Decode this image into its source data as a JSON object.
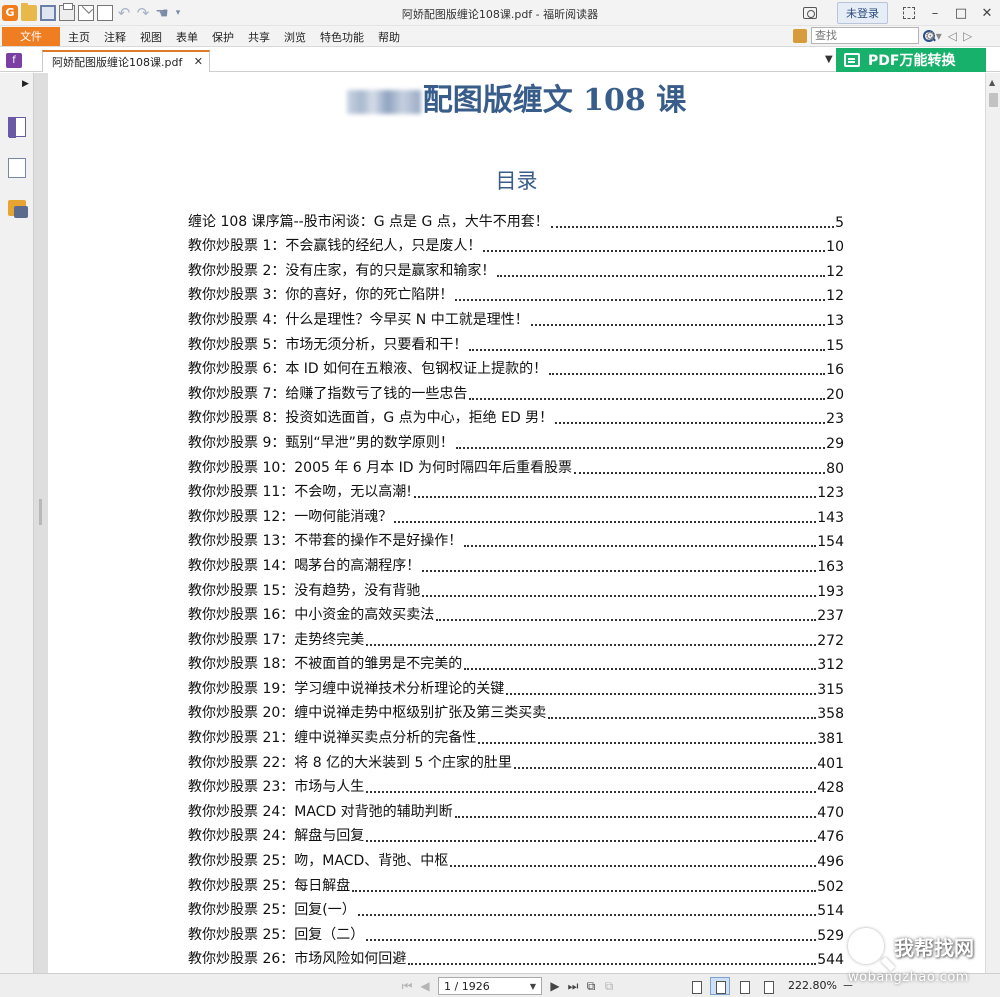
{
  "window": {
    "title": "阿娇配图版缠论108课.pdf - 福昕阅读器",
    "login_label": "未登录"
  },
  "menu": {
    "file": "文件",
    "items": [
      "主页",
      "注释",
      "视图",
      "表单",
      "保护",
      "共享",
      "浏览",
      "特色功能",
      "帮助"
    ],
    "search_placeholder": "查找"
  },
  "tab": {
    "label": "阿娇配图版缠论108课.pdf",
    "close": "✕"
  },
  "promo": {
    "label": "PDF万能转换"
  },
  "document": {
    "title_suffix": "配图版缠文 108 课",
    "toc_heading": "目录",
    "toc": [
      {
        "title": "缠论 108 课序篇--股市闲谈：G 点是 G 点，大牛不用套！",
        "page": "5"
      },
      {
        "title": "教你炒股票 1：不会赢钱的经纪人，只是废人！",
        "page": "10"
      },
      {
        "title": "教你炒股票 2：没有庄家，有的只是赢家和输家！",
        "page": "12"
      },
      {
        "title": "教你炒股票 3：你的喜好，你的死亡陷阱！",
        "page": "12"
      },
      {
        "title": "教你炒股票 4：什么是理性？今早买 N 中工就是理性！",
        "page": "13"
      },
      {
        "title": "教你炒股票 5：市场无须分析，只要看和干！",
        "page": "15"
      },
      {
        "title": "教你炒股票 6：本 ID 如何在五粮液、包钢权证上提款的！",
        "page": "16"
      },
      {
        "title": "教你炒股票 7：给赚了指数亏了钱的一些忠告",
        "page": "20"
      },
      {
        "title": "教你炒股票 8：投资如选面首，G 点为中心，拒绝 ED 男！",
        "page": "23"
      },
      {
        "title": "教你炒股票 9：甄别“早泄”男的数学原则！",
        "page": "29"
      },
      {
        "title": "教你炒股票 10：2005 年 6 月本 ID 为何时隔四年后重看股票",
        "page": "80"
      },
      {
        "title": "教你炒股票 11：不会吻，无以高潮!",
        "page": "123"
      },
      {
        "title": "教你炒股票 12：一吻何能消魂？",
        "page": "143"
      },
      {
        "title": "教你炒股票 13：不带套的操作不是好操作！",
        "page": "154"
      },
      {
        "title": "教你炒股票 14：喝茅台的高潮程序！",
        "page": "163"
      },
      {
        "title": "教你炒股票 15：没有趋势，没有背驰",
        "page": "193"
      },
      {
        "title": "教你炒股票 16：中小资金的高效买卖法",
        "page": "237"
      },
      {
        "title": "教你炒股票 17：走势终完美",
        "page": "272"
      },
      {
        "title": "教你炒股票 18：不被面首的雏男是不完美的",
        "page": "312"
      },
      {
        "title": "教你炒股票 19：学习缠中说禅技术分析理论的关键",
        "page": "315"
      },
      {
        "title": "教你炒股票 20：缠中说禅走势中枢级别扩张及第三类买卖",
        "page": "358"
      },
      {
        "title": "教你炒股票 21：缠中说禅买卖点分析的完备性",
        "page": "381"
      },
      {
        "title": "教你炒股票 22：将 8 亿的大米装到 5 个庄家的肚里",
        "page": "401"
      },
      {
        "title": "教你炒股票 23：市场与人生",
        "page": "428"
      },
      {
        "title": "教你炒股票 24：MACD 对背弛的辅助判断",
        "page": "470"
      },
      {
        "title": "教你炒股票 24：解盘与回复",
        "page": "476"
      },
      {
        "title": "教你炒股票 25：吻，MACD、背弛、中枢",
        "page": "496"
      },
      {
        "title": "教你炒股票 25：每日解盘",
        "page": "502"
      },
      {
        "title": "教你炒股票 25：回复(一）",
        "page": "514"
      },
      {
        "title": "教你炒股票 25：回复（二）",
        "page": "529"
      },
      {
        "title": "教你炒股票 26：市场风险如何回避",
        "page": "544"
      }
    ]
  },
  "status": {
    "page_indicator": "1 / 1926",
    "zoom": "222.80%"
  },
  "watermark": {
    "cn": "我帮找网",
    "en": "wobangzhao.com"
  },
  "colors": {
    "accent_orange": "#ef7d22",
    "promo_green": "#18b16b",
    "title_blue": "#385d8a"
  }
}
